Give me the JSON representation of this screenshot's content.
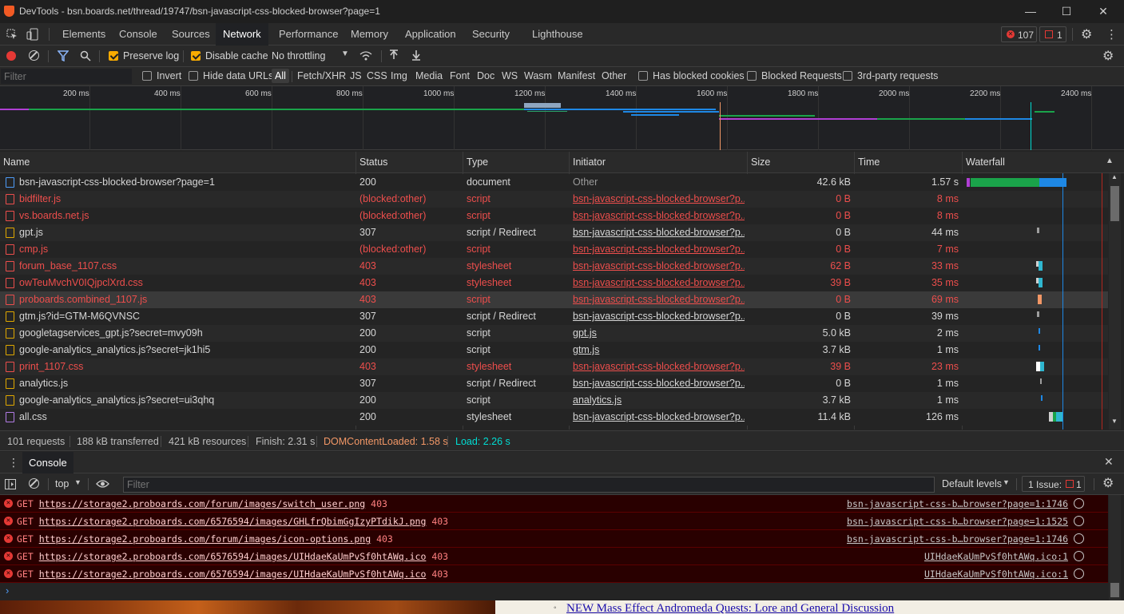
{
  "window": {
    "title": "DevTools - bsn.boards.net/thread/19747/bsn-javascript-css-blocked-browser?page=1"
  },
  "tabs": [
    "Elements",
    "Console",
    "Sources",
    "Network",
    "Performance",
    "Memory",
    "Application",
    "Security",
    "Lighthouse"
  ],
  "badges": {
    "errors": "107",
    "issues": "1"
  },
  "toolbar": {
    "preserve_log": "Preserve log",
    "disable_cache": "Disable cache",
    "throttling": "No throttling"
  },
  "filterbar": {
    "placeholder": "Filter",
    "invert": "Invert",
    "hide_data_urls": "Hide data URLs",
    "types": [
      "All",
      "Fetch/XHR",
      "JS",
      "CSS",
      "Img",
      "Media",
      "Font",
      "Doc",
      "WS",
      "Wasm",
      "Manifest",
      "Other"
    ],
    "has_blocked_cookies": "Has blocked cookies",
    "blocked_requests": "Blocked Requests",
    "third_party": "3rd-party requests"
  },
  "overview": {
    "ticks": [
      "200 ms",
      "400 ms",
      "600 ms",
      "800 ms",
      "1000 ms",
      "1200 ms",
      "1400 ms",
      "1600 ms",
      "1800 ms",
      "2000 ms",
      "2200 ms",
      "2400 ms"
    ]
  },
  "table": {
    "headers": {
      "name": "Name",
      "status": "Status",
      "type": "Type",
      "initiator": "Initiator",
      "size": "Size",
      "time": "Time",
      "waterfall": "Waterfall"
    },
    "rows": [
      {
        "name": "bsn-javascript-css-blocked-browser?page=1",
        "status": "200",
        "type": "document",
        "initiator": "Other",
        "size": "42.6 kB",
        "time": "1.57 s",
        "err": false
      },
      {
        "name": "bidfilter.js",
        "status": "(blocked:other)",
        "type": "script",
        "initiator": "bsn-javascript-css-blocked-browser?p...",
        "size": "0 B",
        "time": "8 ms",
        "err": true
      },
      {
        "name": "vs.boards.net.js",
        "status": "(blocked:other)",
        "type": "script",
        "initiator": "bsn-javascript-css-blocked-browser?p...",
        "size": "0 B",
        "time": "8 ms",
        "err": true
      },
      {
        "name": "gpt.js",
        "status": "307",
        "type": "script / Redirect",
        "initiator": "bsn-javascript-css-blocked-browser?p...",
        "size": "0 B",
        "time": "44 ms",
        "err": false
      },
      {
        "name": "cmp.js",
        "status": "(blocked:other)",
        "type": "script",
        "initiator": "bsn-javascript-css-blocked-browser?p...",
        "size": "0 B",
        "time": "7 ms",
        "err": true
      },
      {
        "name": "forum_base_1107.css",
        "status": "403",
        "type": "stylesheet",
        "initiator": "bsn-javascript-css-blocked-browser?p...",
        "size": "62 B",
        "time": "33 ms",
        "err": true
      },
      {
        "name": "owTeuMvchV0IQjpclXrd.css",
        "status": "403",
        "type": "stylesheet",
        "initiator": "bsn-javascript-css-blocked-browser?p...",
        "size": "39 B",
        "time": "35 ms",
        "err": true
      },
      {
        "name": "proboards.combined_1107.js",
        "status": "403",
        "type": "script",
        "initiator": "bsn-javascript-css-blocked-browser?p...",
        "size": "0 B",
        "time": "69 ms",
        "err": true
      },
      {
        "name": "gtm.js?id=GTM-M6QVNSC",
        "status": "307",
        "type": "script / Redirect",
        "initiator": "bsn-javascript-css-blocked-browser?p...",
        "size": "0 B",
        "time": "39 ms",
        "err": false
      },
      {
        "name": "googletagservices_gpt.js?secret=mvy09h",
        "status": "200",
        "type": "script",
        "initiator": "gpt.js",
        "size": "5.0 kB",
        "time": "2 ms",
        "err": false
      },
      {
        "name": "google-analytics_analytics.js?secret=jk1hi5",
        "status": "200",
        "type": "script",
        "initiator": "gtm.js",
        "size": "3.7 kB",
        "time": "1 ms",
        "err": false
      },
      {
        "name": "print_1107.css",
        "status": "403",
        "type": "stylesheet",
        "initiator": "bsn-javascript-css-blocked-browser?p...",
        "size": "39 B",
        "time": "23 ms",
        "err": true
      },
      {
        "name": "analytics.js",
        "status": "307",
        "type": "script / Redirect",
        "initiator": "bsn-javascript-css-blocked-browser?p...",
        "size": "0 B",
        "time": "1 ms",
        "err": false
      },
      {
        "name": "google-analytics_analytics.js?secret=ui3qhq",
        "status": "200",
        "type": "script",
        "initiator": "analytics.js",
        "size": "3.7 kB",
        "time": "1 ms",
        "err": false
      },
      {
        "name": "all.css",
        "status": "200",
        "type": "stylesheet",
        "initiator": "bsn-javascript-css-blocked-browser?p...",
        "size": "11.4 kB",
        "time": "126 ms",
        "err": false
      }
    ]
  },
  "summary": {
    "requests": "101 requests",
    "transferred": "188 kB transferred",
    "resources": "421 kB resources",
    "finish": "Finish: 2.31 s",
    "dcl": "DOMContentLoaded: 1.58 s",
    "load": "Load: 2.26 s"
  },
  "drawer": {
    "tab": "Console"
  },
  "console_toolbar": {
    "context": "top",
    "filter_placeholder": "Filter",
    "levels": "Default levels",
    "issues_label": "1 Issue:",
    "issues_count": "1"
  },
  "console": [
    {
      "method": "GET",
      "url": "https://storage2.proboards.com/forum/images/switch_user.png",
      "code": "403",
      "source": "bsn-javascript-css-b…browser?page=1:1746"
    },
    {
      "method": "GET",
      "url": "https://storage2.proboards.com/6576594/images/GHLfrQbimGgIzyPTdikJ.png",
      "code": "403",
      "source": "bsn-javascript-css-b…browser?page=1:1525"
    },
    {
      "method": "GET",
      "url": "https://storage2.proboards.com/forum/images/icon-options.png",
      "code": "403",
      "source": "bsn-javascript-css-b…browser?page=1:1746"
    },
    {
      "method": "GET",
      "url": "https://storage2.proboards.com/6576594/images/UIHdaeKaUmPvSf0htAWq.ico",
      "code": "403",
      "source": "UIHdaeKaUmPvSf0htAWq.ico:1"
    },
    {
      "method": "GET",
      "url": "https://storage2.proboards.com/6576594/images/UIHdaeKaUmPvSf0htAWq.ico",
      "code": "403",
      "source": "UIHdaeKaUmPvSf0htAWq.ico:1"
    }
  ],
  "background_page": {
    "link_text": "NEW Mass Effect Andromeda Quests: Lore and General Discussion"
  },
  "colors": {
    "error": "#ed4e4c",
    "dcl": "#f29766",
    "load": "#00ddd3",
    "accent": "#f9ab00",
    "selected": "#3a3a3a"
  }
}
